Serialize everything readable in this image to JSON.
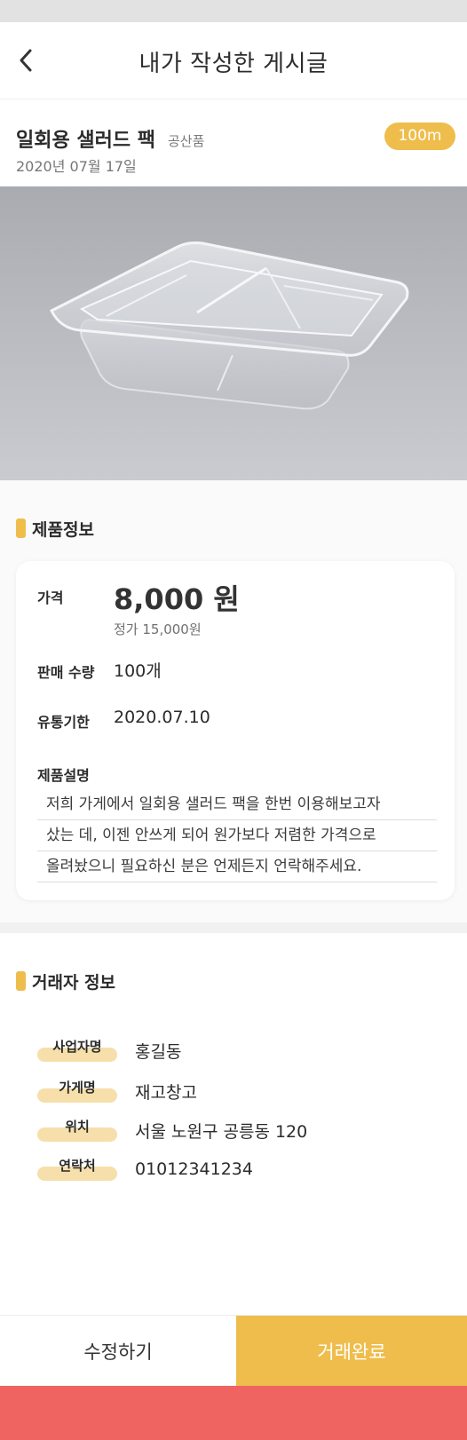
{
  "header": {
    "title": "내가 작성한 게시글",
    "back_icon": "chevron-left-icon"
  },
  "post": {
    "title": "일회용 샐러드 팩",
    "category": "공산품",
    "date": "2020년 07월 17일",
    "distance": "100m"
  },
  "product_section": {
    "title": "제품정보",
    "price_label": "가격",
    "price": "8,000 원",
    "original_price": "정가  15,000원",
    "quantity_label": "판매 수량",
    "quantity": "100개",
    "expiry_label": "유통기한",
    "expiry": "2020.07.10",
    "description_label": "제품설명",
    "description_lines": [
      "저희 가게에서 일회용 샐러드 팩을 한번 이용해보고자",
      "샀는 데, 이젠 안쓰게 되어 원가보다 저렴한 가격으로",
      "올려놨으니 필요하신 분은 언제든지 언락해주세요."
    ]
  },
  "seller_section": {
    "title": "거래자 정보",
    "rows": [
      {
        "label": "사업자명",
        "value": "홍길동"
      },
      {
        "label": "가게명",
        "value": "재고창고"
      },
      {
        "label": "위치",
        "value": "서울 노원구 공릉동 120"
      },
      {
        "label": "연락처",
        "value": "01012341234"
      }
    ]
  },
  "actions": {
    "edit_label": "수정하기",
    "complete_label": "거래완료"
  },
  "colors": {
    "accent": "#efbd4c",
    "accent_light": "#f6dfaa",
    "bottom_strip": "#ef6461"
  }
}
